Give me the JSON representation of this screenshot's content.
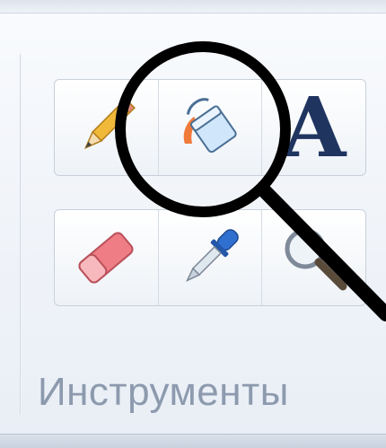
{
  "group": {
    "label": "Инструменты"
  },
  "tools": {
    "row1": [
      {
        "name": "pencil",
        "icon": "pencil-icon"
      },
      {
        "name": "fill",
        "icon": "paint-bucket-icon"
      },
      {
        "name": "text",
        "icon": "text-icon",
        "glyph": "A"
      }
    ],
    "row2": [
      {
        "name": "eraser",
        "icon": "eraser-icon"
      },
      {
        "name": "color-picker",
        "icon": "eyedropper-icon"
      },
      {
        "name": "magnifier",
        "icon": "magnifier-icon"
      }
    ]
  },
  "overlay": {
    "icon": "magnifying-glass-overlay"
  }
}
